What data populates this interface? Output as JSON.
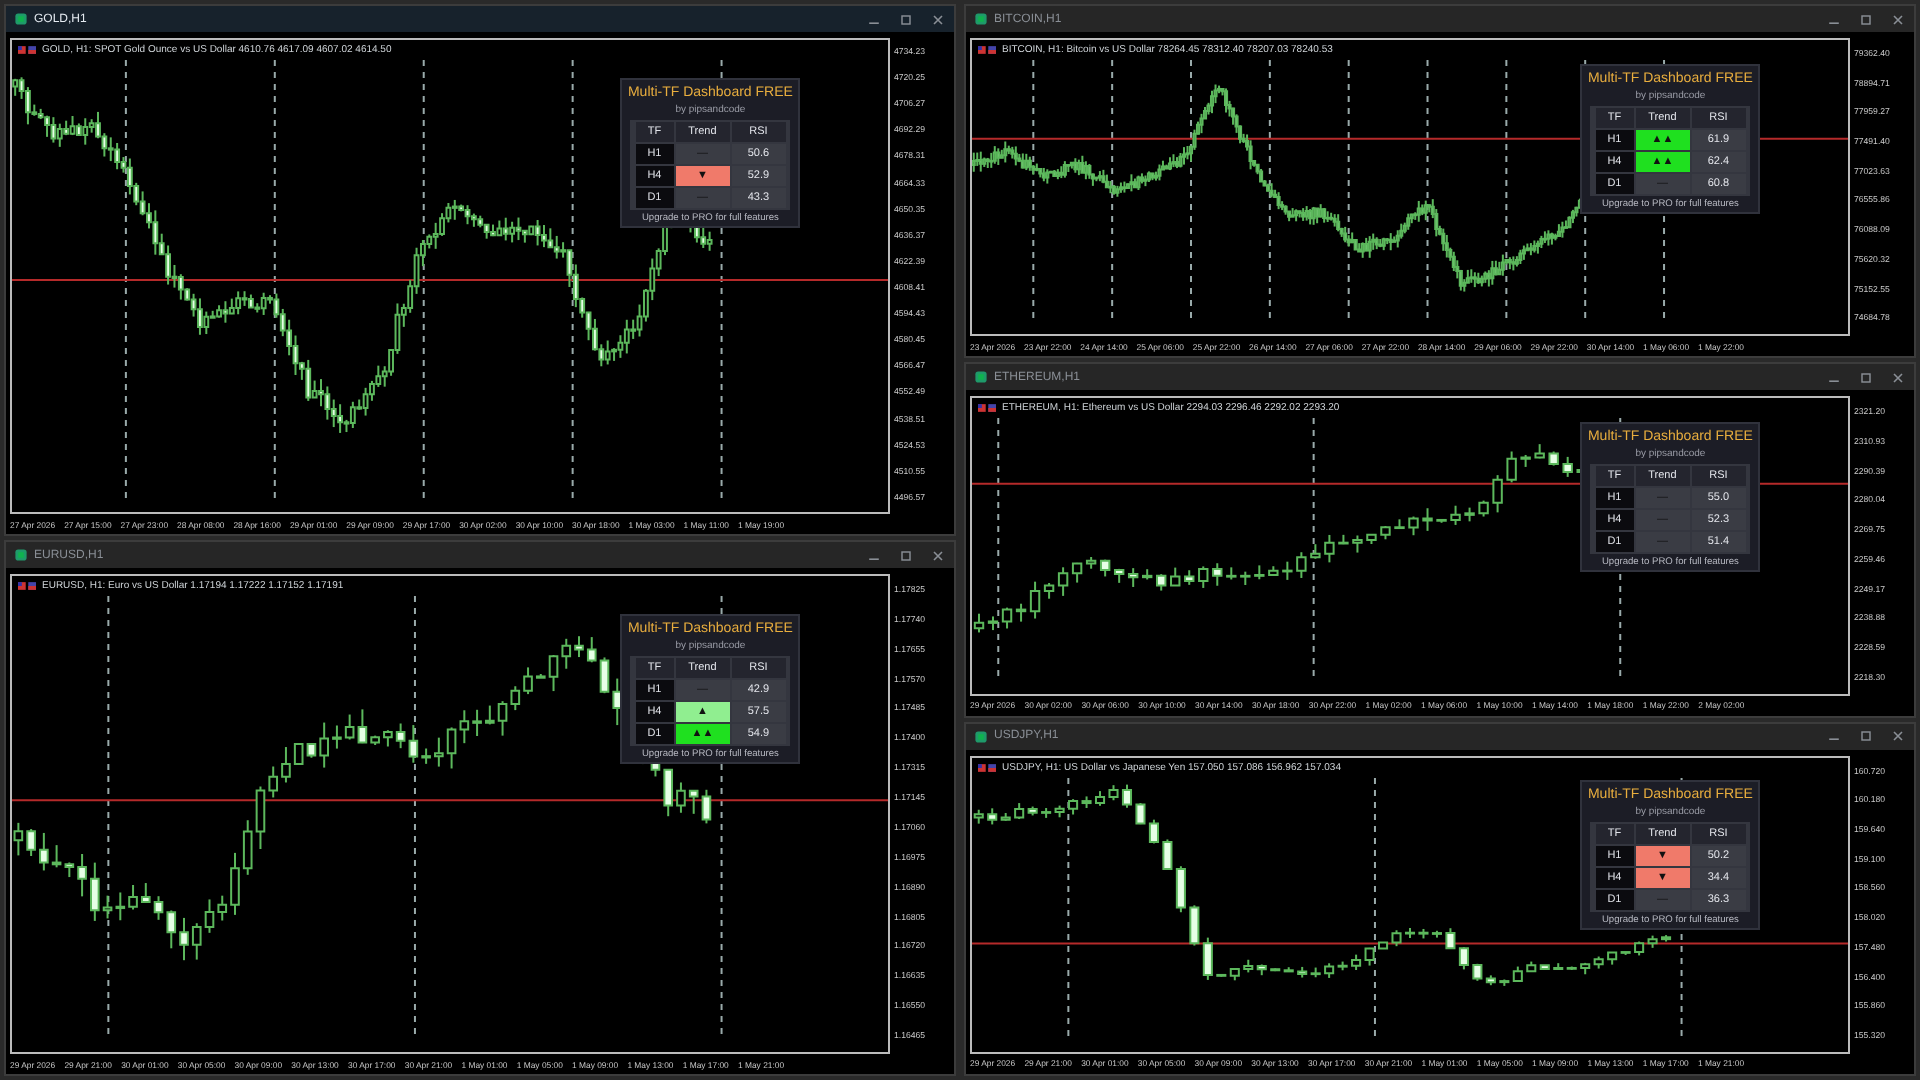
{
  "windows": [
    {
      "kind": "gold",
      "title": "GOLD,H1",
      "active": true,
      "info": "GOLD, H1: SPOT Gold Ounce vs US Dollar 4610.76 4617.09 4607.02 4614.50",
      "prices": [
        "4734.23",
        "4720.25",
        "4706.27",
        "4692.29",
        "4678.31",
        "4664.33",
        "4650.35",
        "4636.37",
        "4622.39",
        "4608.41",
        "4594.43",
        "4580.45",
        "4566.47",
        "4552.49",
        "4538.51",
        "4524.53",
        "4510.55",
        "4496.57"
      ],
      "times": [
        "27 Apr 2026",
        "27 Apr 15:00",
        "27 Apr 23:00",
        "28 Apr 08:00",
        "28 Apr 16:00",
        "29 Apr 01:00",
        "29 Apr 09:00",
        "29 Apr 17:00",
        "30 Apr 02:00",
        "30 Apr 10:00",
        "30 Apr 18:00",
        "1 May 03:00",
        "1 May 11:00",
        "1 May 19:00"
      ],
      "dashboard": {
        "title": "Multi-TF Dashboard FREE",
        "author": "by pipsandcode",
        "headers": [
          "TF",
          "Trend",
          "RSI"
        ],
        "footer": "Upgrade to PRO for full features",
        "rows": [
          {
            "tf": "H1",
            "trend": "—",
            "color": "#3a3c44",
            "rsi": "50.6"
          },
          {
            "tf": "H4",
            "trend": "▼",
            "color": "#f07a6a",
            "rsi": "52.9"
          },
          {
            "tf": "D1",
            "trend": "—",
            "color": "#3a3c44",
            "rsi": "43.3"
          }
        ]
      }
    },
    {
      "kind": "eurusd",
      "title": "EURUSD,H1",
      "active": false,
      "info": "EURUSD, H1: Euro vs US Dollar 1.17194 1.17222 1.17152 1.17191",
      "prices": [
        "1.17825",
        "1.17740",
        "1.17655",
        "1.17570",
        "1.17485",
        "1.17400",
        "1.17315",
        "1.17145",
        "1.17060",
        "1.16975",
        "1.16890",
        "1.16805",
        "1.16720",
        "1.16635",
        "1.16550",
        "1.16465"
      ],
      "times": [
        "29 Apr 2026",
        "29 Apr 21:00",
        "30 Apr 01:00",
        "30 Apr 05:00",
        "30 Apr 09:00",
        "30 Apr 13:00",
        "30 Apr 17:00",
        "30 Apr 21:00",
        "1 May 01:00",
        "1 May 05:00",
        "1 May 09:00",
        "1 May 13:00",
        "1 May 17:00",
        "1 May 21:00"
      ],
      "dashboard": {
        "title": "Multi-TF Dashboard FREE",
        "author": "by pipsandcode",
        "headers": [
          "TF",
          "Trend",
          "RSI"
        ],
        "footer": "Upgrade to PRO for full features",
        "rows": [
          {
            "tf": "H1",
            "trend": "—",
            "color": "#3a3c44",
            "rsi": "42.9"
          },
          {
            "tf": "H4",
            "trend": "▲",
            "color": "#90ee90",
            "rsi": "57.5"
          },
          {
            "tf": "D1",
            "trend": "▲▲",
            "color": "#1fe01f",
            "rsi": "54.9"
          }
        ]
      }
    },
    {
      "kind": "btc",
      "title": "BITCOIN,H1",
      "active": false,
      "info": "BITCOIN, H1: Bitcoin vs US Dollar 78264.45 78312.40 78207.03 78240.53",
      "prices": [
        "79362.40",
        "78894.71",
        "77959.27",
        "77491.40",
        "77023.63",
        "76555.86",
        "76088.09",
        "75620.32",
        "75152.55",
        "74684.78"
      ],
      "times": [
        "23 Apr 2026",
        "23 Apr 22:00",
        "24 Apr 14:00",
        "25 Apr 06:00",
        "25 Apr 22:00",
        "26 Apr 14:00",
        "27 Apr 06:00",
        "27 Apr 22:00",
        "28 Apr 14:00",
        "29 Apr 06:00",
        "29 Apr 22:00",
        "30 Apr 14:00",
        "1 May 06:00",
        "1 May 22:00"
      ],
      "dashboard": {
        "title": "Multi-TF Dashboard FREE",
        "author": "by pipsandcode",
        "headers": [
          "TF",
          "Trend",
          "RSI"
        ],
        "footer": "Upgrade to PRO for full features",
        "rows": [
          {
            "tf": "H1",
            "trend": "▲▲",
            "color": "#1fe01f",
            "rsi": "61.9"
          },
          {
            "tf": "H4",
            "trend": "▲▲",
            "color": "#1fe01f",
            "rsi": "62.4"
          },
          {
            "tf": "D1",
            "trend": "—",
            "color": "#3a3c44",
            "rsi": "60.8"
          }
        ]
      }
    },
    {
      "kind": "eth",
      "title": "ETHEREUM,H1",
      "active": false,
      "info": "ETHEREUM, H1: Ethereum vs US Dollar 2294.03 2296.46 2292.02 2293.20",
      "prices": [
        "2321.20",
        "2310.93",
        "2290.39",
        "2280.04",
        "2269.75",
        "2259.46",
        "2249.17",
        "2238.88",
        "2228.59",
        "2218.30"
      ],
      "times": [
        "29 Apr 2026",
        "30 Apr 02:00",
        "30 Apr 06:00",
        "30 Apr 10:00",
        "30 Apr 14:00",
        "30 Apr 18:00",
        "30 Apr 22:00",
        "1 May 02:00",
        "1 May 06:00",
        "1 May 10:00",
        "1 May 14:00",
        "1 May 18:00",
        "1 May 22:00",
        "2 May 02:00"
      ],
      "dashboard": {
        "title": "Multi-TF Dashboard FREE",
        "author": "by pipsandcode",
        "headers": [
          "TF",
          "Trend",
          "RSI"
        ],
        "footer": "Upgrade to PRO for full features",
        "rows": [
          {
            "tf": "H1",
            "trend": "—",
            "color": "#3a3c44",
            "rsi": "55.0"
          },
          {
            "tf": "H4",
            "trend": "—",
            "color": "#3a3c44",
            "rsi": "52.3"
          },
          {
            "tf": "D1",
            "trend": "—",
            "color": "#3a3c44",
            "rsi": "51.4"
          }
        ]
      }
    },
    {
      "kind": "usdjpy",
      "title": "USDJPY,H1",
      "active": false,
      "info": "USDJPY, H1: US Dollar vs Japanese Yen 157.050 157.086 156.962 157.034",
      "prices": [
        "160.720",
        "160.180",
        "159.640",
        "159.100",
        "158.560",
        "158.020",
        "157.480",
        "156.400",
        "155.860",
        "155.320"
      ],
      "times": [
        "29 Apr 2026",
        "29 Apr 21:00",
        "30 Apr 01:00",
        "30 Apr 05:00",
        "30 Apr 09:00",
        "30 Apr 13:00",
        "30 Apr 17:00",
        "30 Apr 21:00",
        "1 May 01:00",
        "1 May 05:00",
        "1 May 09:00",
        "1 May 13:00",
        "1 May 17:00",
        "1 May 21:00"
      ],
      "dashboard": {
        "title": "Multi-TF Dashboard FREE",
        "author": "by pipsandcode",
        "headers": [
          "TF",
          "Trend",
          "RSI"
        ],
        "footer": "Upgrade to PRO for full features",
        "rows": [
          {
            "tf": "H1",
            "trend": "▼",
            "color": "#f07a6a",
            "rsi": "50.2"
          },
          {
            "tf": "H4",
            "trend": "▼",
            "color": "#f07a6a",
            "rsi": "34.4"
          },
          {
            "tf": "D1",
            "trend": "—",
            "color": "#3a3c44",
            "rsi": "36.3"
          }
        ]
      }
    }
  ]
}
